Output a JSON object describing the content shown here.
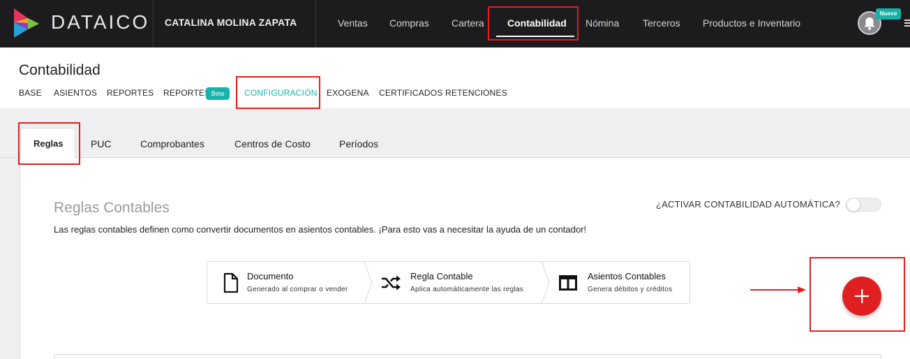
{
  "navbar": {
    "brand": "DATAICO",
    "company": "CATALINA MOLINA ZAPATA",
    "items": [
      {
        "label": "Ventas"
      },
      {
        "label": "Compras"
      },
      {
        "label": "Cartera"
      },
      {
        "label": "Contabilidad",
        "active": true
      },
      {
        "label": "Nómina"
      },
      {
        "label": "Terceros"
      },
      {
        "label": "Productos e Inventario"
      }
    ],
    "notifications_badge": "Nuevo",
    "icons": {
      "logo": "dataico-logo-icon",
      "bell": "bell-icon",
      "menu": "hamburger-icon"
    },
    "colors": {
      "background": "#1c1c1e"
    }
  },
  "header": {
    "title": "Contabilidad",
    "subnav": [
      {
        "label": "BASE"
      },
      {
        "label": "ASIENTOS"
      },
      {
        "label": "REPORTES"
      },
      {
        "label": "REPORTES",
        "badge": "Beta"
      },
      {
        "label": "CONFIGURACIÓN",
        "active": true
      },
      {
        "label": "EXOGENA"
      },
      {
        "label": "CERTIFICADOS RETENCIONES"
      }
    ]
  },
  "tabs": [
    {
      "label": "Reglas",
      "active": true
    },
    {
      "label": "PUC"
    },
    {
      "label": "Comprobantes"
    },
    {
      "label": "Centros de Costo"
    },
    {
      "label": "Períodos"
    }
  ],
  "reglas": {
    "title": "Reglas Contables",
    "description": "Las reglas contables definen como convertir documentos en asientos contables. ¡Para esto vas a necesitar la ayuda de un contador!",
    "auto_toggle_label": "¿ACTIVAR CONTABILIDAD AUTOMÁTICA?",
    "auto_toggle_on": false,
    "flow": [
      {
        "title": "Documento",
        "subtitle": "Generado al comprar o vender",
        "icon": "document-icon"
      },
      {
        "title": "Regla Contable",
        "subtitle": "Aplica automáticamente las reglas",
        "icon": "shuffle-icon"
      },
      {
        "title": "Asientos Contables",
        "subtitle": "Genera débitos y créditos",
        "icon": "columns-icon"
      }
    ],
    "add_button_icon": "plus-icon"
  },
  "colors": {
    "accent": "#17b3a8",
    "fab": "#e02020",
    "annotation": "#e41e1e"
  }
}
